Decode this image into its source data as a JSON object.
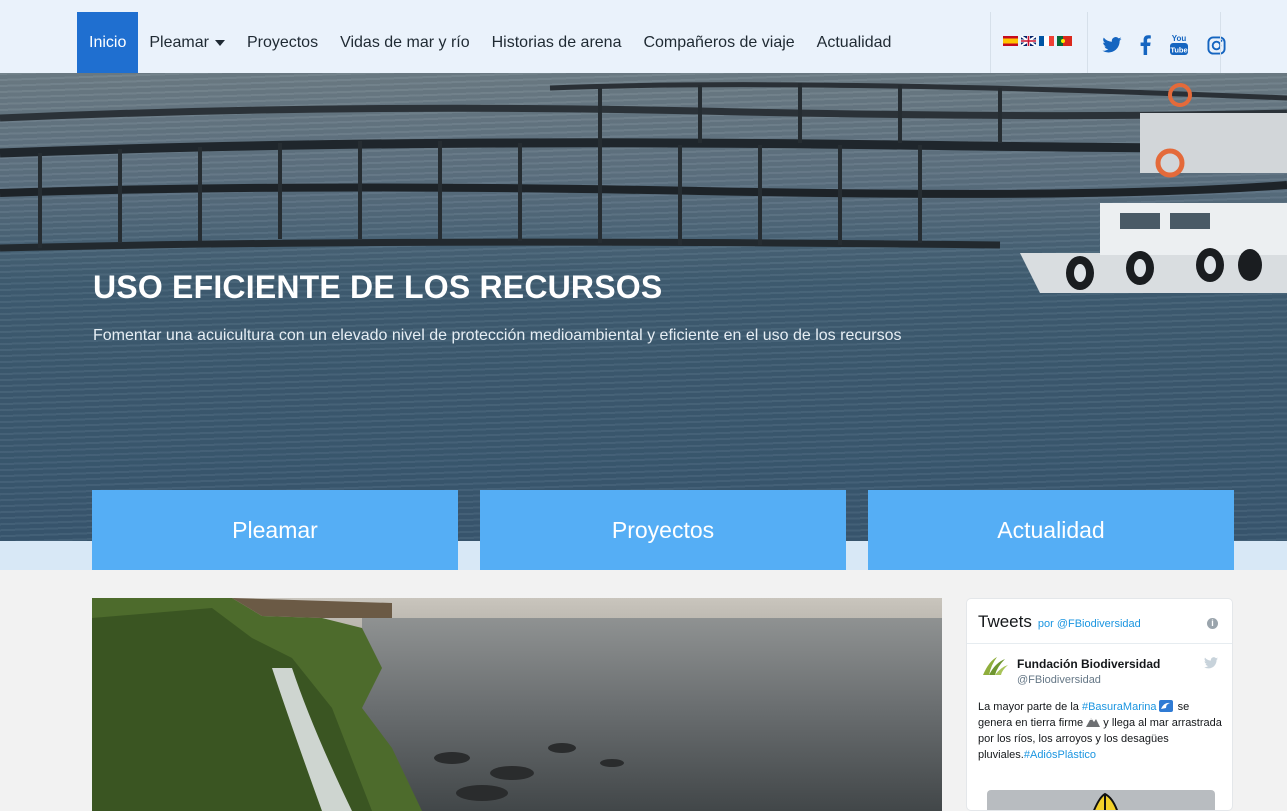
{
  "nav": {
    "items": [
      "Inicio",
      "Pleamar",
      "Proyectos",
      "Vidas de mar y río",
      "Historias de arena",
      "Compañeros de viaje",
      "Actualidad"
    ]
  },
  "languages": [
    "es",
    "en",
    "fr",
    "pt"
  ],
  "social": [
    "twitter-icon",
    "facebook-icon",
    "youtube-icon",
    "instagram-icon"
  ],
  "youtube": {
    "top": "You",
    "bottom": "Tube"
  },
  "hero": {
    "title": "USO EFICIENTE DE LOS RECURSOS",
    "subtitle": "Fomentar una acuicultura con un elevado nivel de protección medioambiental y eficiente en el uso de los recursos"
  },
  "tiles": [
    "Pleamar",
    "Proyectos",
    "Actualidad"
  ],
  "tweets": {
    "title": "Tweets",
    "by": "por @FBiodiversidad",
    "info": "i",
    "account_name": "Fundación Biodiversidad",
    "account_handle": "@FBiodiversidad",
    "text_1": "La mayor parte de la ",
    "tag_1": "#BasuraMarina",
    "text_2": " se genera en tierra firme ",
    "text_3": " y llega al mar arrastrada por los ríos, los arroyos y los desagües pluviales.",
    "tag_2": "#AdiósPlástico"
  },
  "colors": {
    "accent": "#1f6fd0",
    "tile": "#55aef5",
    "link": "#1b95e0"
  }
}
